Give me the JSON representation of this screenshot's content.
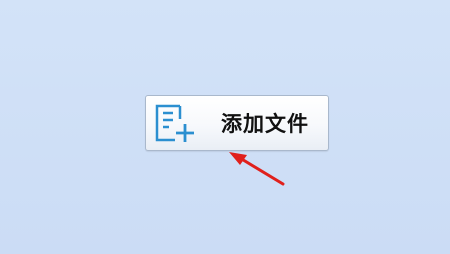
{
  "add_file_button": {
    "label": "添加文件",
    "icon": "file-add-icon"
  },
  "colors": {
    "background": "#cfe0f7",
    "icon": "#2b8fd0",
    "arrow": "#e0201c"
  }
}
